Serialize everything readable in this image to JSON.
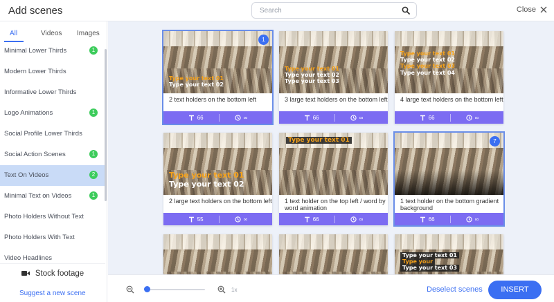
{
  "header": {
    "title": "Add scenes",
    "search_placeholder": "Search",
    "close_label": "Close"
  },
  "sidebar": {
    "tabs": [
      {
        "label": "All",
        "active": true
      },
      {
        "label": "Videos",
        "active": false
      },
      {
        "label": "Images",
        "active": false
      }
    ],
    "categories": [
      {
        "label": "Minimal Lower Thirds",
        "badge": "1",
        "selected": false
      },
      {
        "label": "Modern Lower Thirds",
        "badge": "",
        "selected": false
      },
      {
        "label": "Informative Lower Thirds",
        "badge": "",
        "selected": false
      },
      {
        "label": "Logo Animations",
        "badge": "1",
        "selected": false
      },
      {
        "label": "Social Profile Lower Thirds",
        "badge": "",
        "selected": false
      },
      {
        "label": "Social Action Scenes",
        "badge": "1",
        "selected": false
      },
      {
        "label": "Text On Videos",
        "badge": "2",
        "selected": true
      },
      {
        "label": "Minimal Text on Videos",
        "badge": "1",
        "selected": false
      },
      {
        "label": "Photo Holders Without Text",
        "badge": "",
        "selected": false
      },
      {
        "label": "Photo Holders With Text",
        "badge": "",
        "selected": false
      },
      {
        "label": "Video Headlines",
        "badge": "",
        "selected": false
      }
    ],
    "stock_footage_label": "Stock footage",
    "suggest_label": "Suggest a new scene"
  },
  "scenes": [
    {
      "title": "2 text holders on the bottom left",
      "chars": "66",
      "duration": "∞",
      "badge": "1",
      "selected": true,
      "overlay": [
        {
          "text": "Type your text 01",
          "color": "orange"
        },
        {
          "text": "Type your text 02",
          "color": "white"
        }
      ]
    },
    {
      "title": "3 large text holders on the bottom left",
      "chars": "66",
      "duration": "∞",
      "badge": "",
      "selected": false,
      "overlay": [
        {
          "text": "Type your text 01",
          "color": "orange"
        },
        {
          "text": "Type your text 02",
          "color": "white"
        },
        {
          "text": "Type your text 03",
          "color": "white"
        }
      ]
    },
    {
      "title": "4 large text holders on the bottom left",
      "chars": "66",
      "duration": "∞",
      "badge": "",
      "selected": false,
      "overlay": [
        {
          "text": "Type your text 01",
          "color": "orange"
        },
        {
          "text": "Type your text 02",
          "color": "white"
        },
        {
          "text": "Type your text 03",
          "color": "orange"
        },
        {
          "text": "Type your text 04",
          "color": "white"
        }
      ]
    },
    {
      "title": "2 large text holders on the bottom left",
      "chars": "55",
      "duration": "∞",
      "badge": "",
      "selected": false,
      "overlay": [
        {
          "text": "Type your text 01",
          "color": "orange"
        },
        {
          "text": "Type your text 02",
          "color": "white"
        }
      ]
    },
    {
      "title": "1 text holder on the top left / word by word animation",
      "chars": "66",
      "duration": "∞",
      "badge": "",
      "selected": false,
      "overlay": [
        {
          "text": "Type your text 01",
          "color": "orange"
        }
      ]
    },
    {
      "title": "1 text holder on the bottom gradient background",
      "chars": "66",
      "duration": "∞",
      "badge": "7",
      "selected": true,
      "overlay": []
    },
    {
      "title": "",
      "chars": "",
      "duration": "",
      "badge": "",
      "selected": false,
      "overlay": []
    },
    {
      "title": "",
      "chars": "",
      "duration": "",
      "badge": "",
      "selected": false,
      "overlay": []
    },
    {
      "title": "",
      "chars": "",
      "duration": "",
      "badge": "",
      "selected": false,
      "overlay": [
        {
          "text": "Type your text 01",
          "color": "white"
        },
        {
          "text": "Type your",
          "color": "orange"
        },
        {
          "text": "Type your text 03",
          "color": "white"
        }
      ]
    }
  ],
  "bottom": {
    "zoom_level": "1x",
    "zoom_value": 0,
    "deselect_label": "Deselect scenes",
    "insert_label": "INSERT"
  },
  "colors": {
    "accent": "#3b6ff2",
    "card_footer": "#7c6cf2",
    "badge_green": "#3dcc5c",
    "selected_category": "#c9dbf7",
    "overlay_orange": "#f6a21a"
  }
}
